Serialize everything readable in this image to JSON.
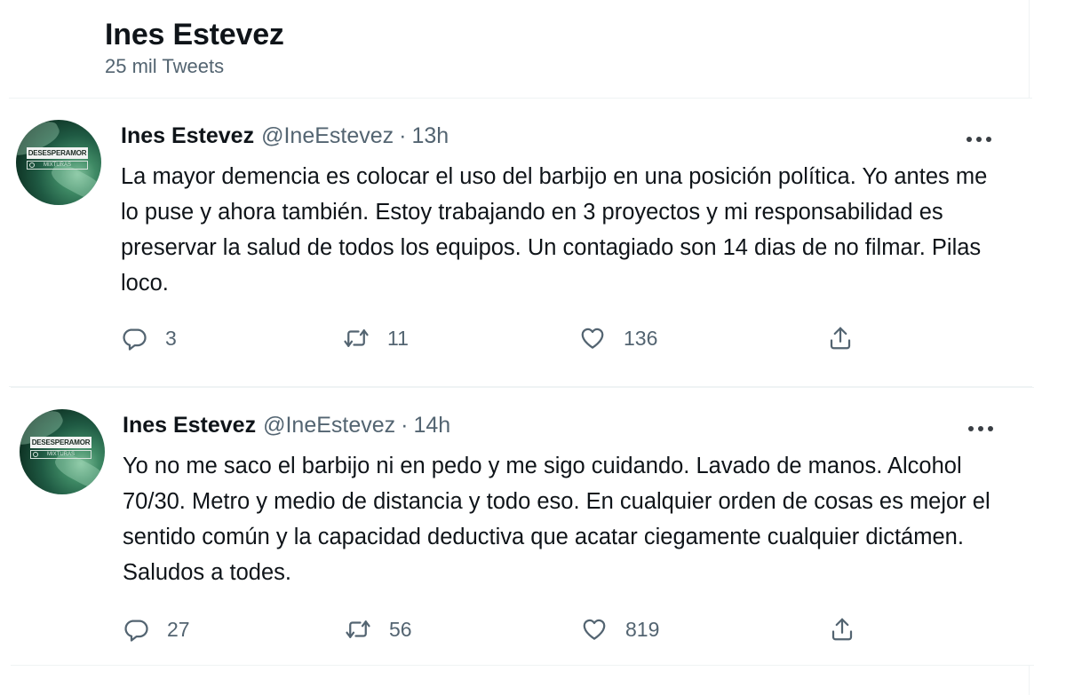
{
  "profile": {
    "name": "Ines Estevez",
    "tweet_count": "25 mil Tweets"
  },
  "tweets": [
    {
      "name": "Ines Estevez",
      "handle": "@IneEstevez",
      "separator": "·",
      "time": "13h",
      "text": "La mayor demencia es colocar el uso del barbijo en una posición política. Yo antes me lo puse y ahora también. Estoy trabajando en 3 proyectos y mi responsabilidad es preservar la salud de todos los equipos. Un contagiado son 14 dias de no filmar. Pilas loco.",
      "avatar_label": "DESESPERAMOR",
      "avatar_sub": "MIXTURAS",
      "replies": "3",
      "retweets": "11",
      "likes": "136"
    },
    {
      "name": "Ines Estevez",
      "handle": "@IneEstevez",
      "separator": "·",
      "time": "14h",
      "text": "Yo no me saco el barbijo ni en pedo y me sigo cuidando. Lavado de manos. Alcohol 70/30. Metro y medio de distancia y todo eso. En cualquier orden de cosas es mejor el sentido común y la capacidad deductiva que acatar ciegamente cualquier dictámen. Saludos a todes.",
      "avatar_label": "DESESPERAMOR",
      "avatar_sub": "MIXTURAS",
      "replies": "27",
      "retweets": "56",
      "likes": "819"
    }
  ],
  "icons": {
    "reply": "reply-icon",
    "retweet": "retweet-icon",
    "like": "heart-icon",
    "share": "share-icon",
    "more": "more-icon"
  },
  "colors": {
    "text": "#0f1419",
    "secondary": "#536471",
    "border": "#eff3f4"
  }
}
